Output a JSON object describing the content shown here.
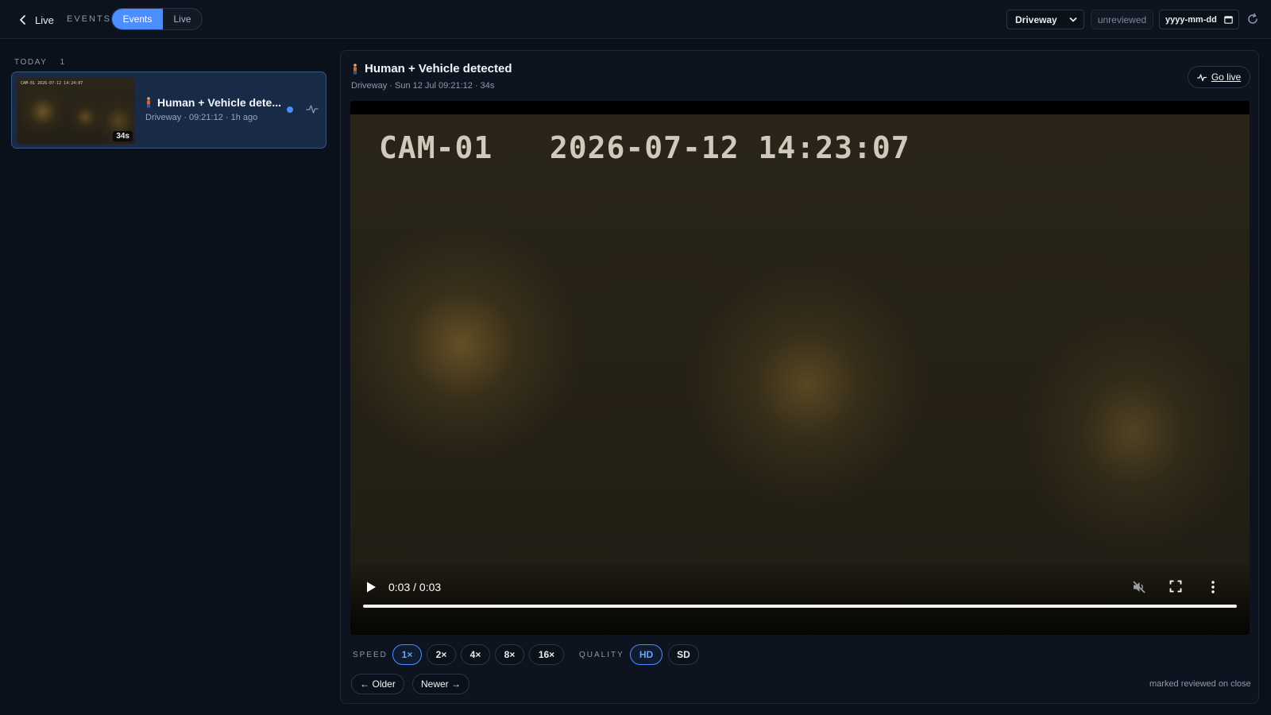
{
  "header": {
    "back_label": "Live",
    "section_label": "EVENTS",
    "tabs": [
      {
        "label": "Events",
        "active": true
      },
      {
        "label": "Live",
        "active": false
      }
    ],
    "camera_select": {
      "value": "Driveway"
    },
    "filter_label": "unreviewed",
    "date_input": {
      "placeholder": "yyyy-mm-dd"
    },
    "accent_color": "#4c8dff"
  },
  "sidebar": {
    "groups": [
      {
        "label": "TODAY",
        "count": "1",
        "events": [
          {
            "thumb_osd": "CAM-01  2026-07-12 14:24:07",
            "duration": "34s",
            "title": "Human + Vehicle dete...",
            "meta": "Driveway · 09:21:12 · 1h ago",
            "unread": true
          }
        ]
      }
    ]
  },
  "player": {
    "title": "Human + Vehicle detected",
    "subtitle": "Driveway · Sun 12 Jul 09:21:12 · 34s",
    "go_live_label": "Go live",
    "video_osd": "CAM-01   2026-07-12 14:23:07",
    "time": "0:03 / 0:03",
    "progress": 1.0,
    "muted": true,
    "speed_label": "SPEED",
    "speeds": [
      "1×",
      "2×",
      "4×",
      "8×",
      "16×"
    ],
    "speed_selected": "1×",
    "quality_label": "QUALITY",
    "qualities": [
      "HD",
      "SD"
    ],
    "quality_selected": "HD",
    "older_label": "← Older",
    "newer_label": "Newer →",
    "footer_note": "marked reviewed on close"
  }
}
